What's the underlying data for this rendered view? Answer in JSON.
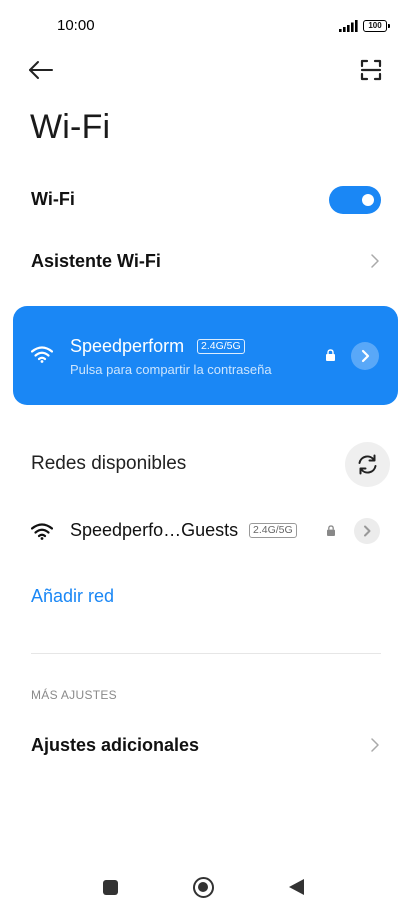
{
  "status_bar": {
    "time": "10:00",
    "battery": "100",
    "icons": [
      "signal-icon",
      "battery-icon"
    ]
  },
  "header": {
    "back_icon": "back-arrow-icon",
    "scan_icon": "qr-scan-icon",
    "title": "Wi-Fi"
  },
  "wifi_toggle": {
    "label": "Wi-Fi",
    "enabled": true
  },
  "assistant": {
    "label": "Asistente Wi-Fi"
  },
  "connected_network": {
    "name": "Speedperform",
    "band": "2.4G/5G",
    "subtitle": "Pulsa para compartir la contraseña",
    "secured": true
  },
  "available": {
    "title": "Redes disponibles",
    "refresh_icon": "refresh-icon",
    "networks": [
      {
        "name": "Speedperfo…Guests",
        "band": "2.4G/5G",
        "secured": true
      }
    ]
  },
  "add_network": {
    "label": "Añadir red"
  },
  "more_settings": {
    "section_label": "MÁS AJUSTES",
    "additional_label": "Ajustes adicionales"
  },
  "nav_bar": {
    "icons": [
      "recents-icon",
      "home-icon",
      "back-icon"
    ]
  },
  "colors": {
    "accent": "#1a87f5",
    "background": "#ffffff"
  }
}
